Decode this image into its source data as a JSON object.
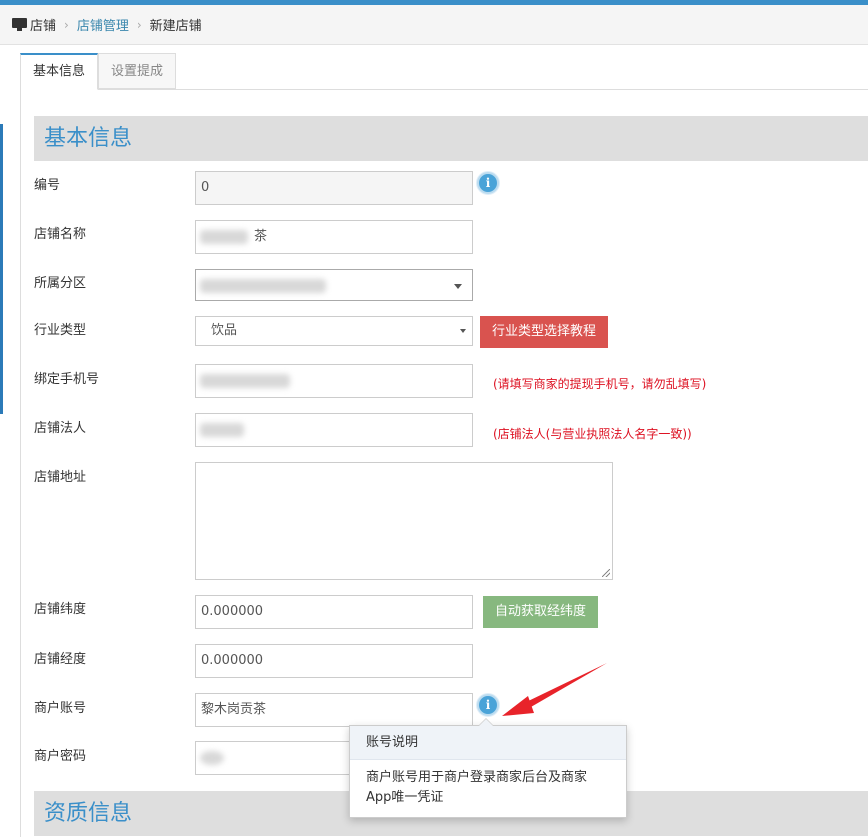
{
  "breadcrumb": {
    "home": "店铺",
    "parent": "店铺管理",
    "current": "新建店铺"
  },
  "tabs": [
    "基本信息",
    "设置提成"
  ],
  "sections": {
    "basic": "基本信息",
    "qualification": "资质信息"
  },
  "fields": {
    "number": {
      "label": "编号",
      "value": "0"
    },
    "shop_name": {
      "label": "店铺名称",
      "value": "茶"
    },
    "district": {
      "label": "所属分区"
    },
    "industry": {
      "label": "行业类型",
      "value": "饮品",
      "tutorial_button": "行业类型选择教程"
    },
    "phone": {
      "label": "绑定手机号",
      "hint": "(请填写商家的提现手机号，请勿乱填写)"
    },
    "legal_person": {
      "label": "店铺法人",
      "hint": "(店铺法人(与营业执照法人名字一致))"
    },
    "address": {
      "label": "店铺地址"
    },
    "latitude": {
      "label": "店铺纬度",
      "value": "0.000000",
      "auto_button": "自动获取经纬度"
    },
    "longitude": {
      "label": "店铺经度",
      "value": "0.000000"
    },
    "account": {
      "label": "商户账号",
      "value": "黎木岗贡茶"
    },
    "password": {
      "label": "商户密码"
    }
  },
  "popover": {
    "title": "账号说明",
    "body": "商户账号用于商户登录商家后台及商家App唯一凭证"
  },
  "colors": {
    "accent": "#3a8fc9",
    "danger": "#d9534f",
    "success": "#87b87f",
    "annotation": "#e8232a"
  }
}
